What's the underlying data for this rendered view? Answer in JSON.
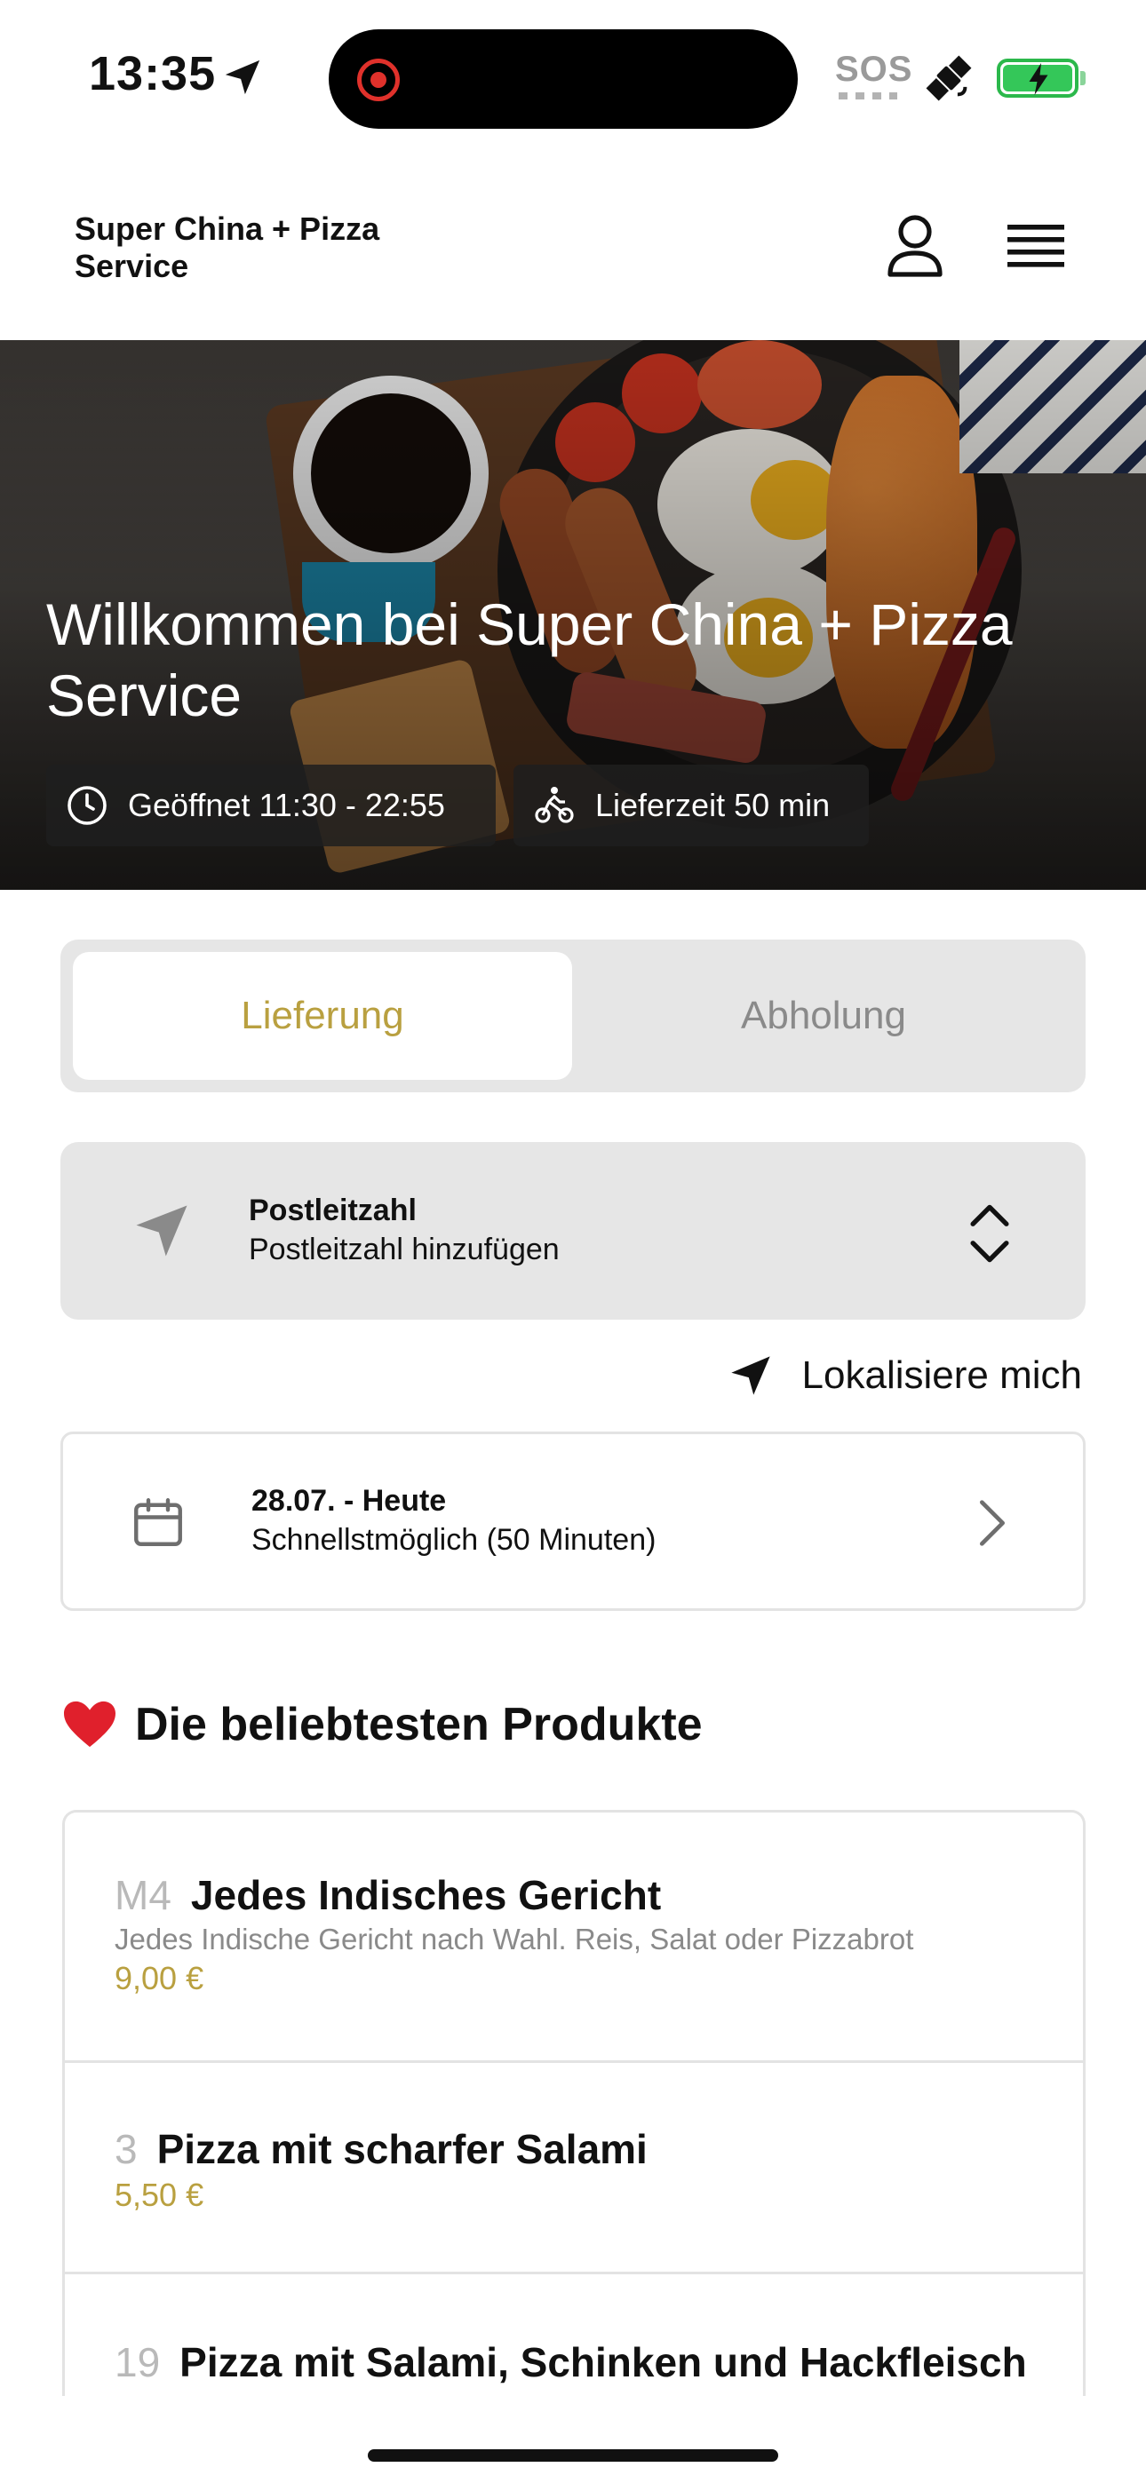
{
  "status_bar": {
    "time": "13:35",
    "sos": "SOS",
    "icons": [
      "location-arrow-icon",
      "recording-indicator-icon",
      "satellite-icon",
      "battery-charging-icon"
    ]
  },
  "header": {
    "brand": "Super China + Pizza Service",
    "icons": [
      "user-icon",
      "menu-icon"
    ]
  },
  "hero": {
    "title": "Willkommen bei Super China + Pizza Service",
    "hours": "Geöffnet 11:30 - 22:55",
    "delivery_time": "Lieferzeit 50 min"
  },
  "mode_toggle": {
    "tabs": [
      {
        "label": "Lieferung",
        "active": true
      },
      {
        "label": "Abholung",
        "active": false
      }
    ]
  },
  "postcode": {
    "label": "Postleitzahl",
    "placeholder": "Postleitzahl hinzufügen"
  },
  "locate": {
    "label": "Lokalisiere mich"
  },
  "date": {
    "label": "28.07. - Heute",
    "sub": "Schnellstmöglich (50 Minuten)"
  },
  "popular": {
    "title": "Die beliebtesten Produkte",
    "items": [
      {
        "num": "M4",
        "name": "Jedes Indisches Gericht",
        "desc": "Jedes Indische Gericht nach Wahl. Reis, Salat oder Pizzabrot",
        "price": "9,00 €"
      },
      {
        "num": "3",
        "name": "Pizza mit scharfer Salami",
        "desc": "",
        "price": "5,50 €"
      },
      {
        "num": "19",
        "name": "Pizza mit Salami, Schinken und Hackfleisch",
        "desc": "",
        "price": ""
      }
    ]
  },
  "colors": {
    "accent": "#b9a040",
    "panel": "#e6e6e6",
    "text": "#111111",
    "muted": "#8a8a8a",
    "heart": "#e0202c"
  }
}
